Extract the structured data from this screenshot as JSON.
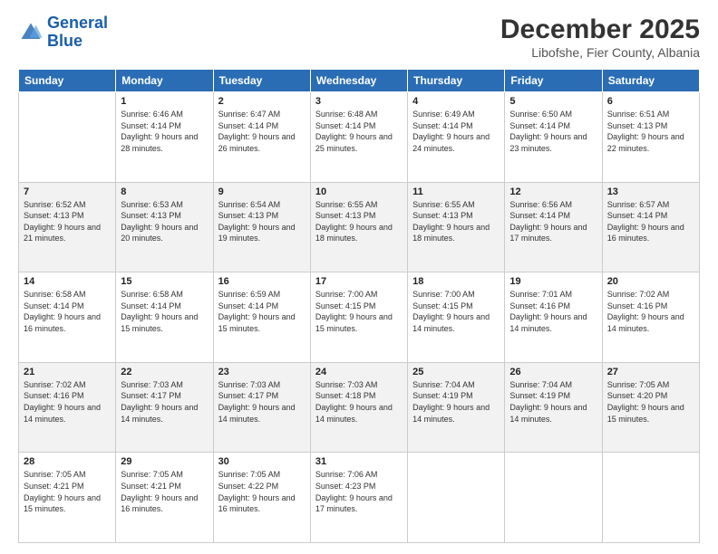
{
  "logo": {
    "line1": "General",
    "line2": "Blue"
  },
  "title": "December 2025",
  "subtitle": "Libofshe, Fier County, Albania",
  "days_of_week": [
    "Sunday",
    "Monday",
    "Tuesday",
    "Wednesday",
    "Thursday",
    "Friday",
    "Saturday"
  ],
  "weeks": [
    [
      {
        "num": "",
        "sunrise": "",
        "sunset": "",
        "daylight": ""
      },
      {
        "num": "1",
        "sunrise": "Sunrise: 6:46 AM",
        "sunset": "Sunset: 4:14 PM",
        "daylight": "Daylight: 9 hours and 28 minutes."
      },
      {
        "num": "2",
        "sunrise": "Sunrise: 6:47 AM",
        "sunset": "Sunset: 4:14 PM",
        "daylight": "Daylight: 9 hours and 26 minutes."
      },
      {
        "num": "3",
        "sunrise": "Sunrise: 6:48 AM",
        "sunset": "Sunset: 4:14 PM",
        "daylight": "Daylight: 9 hours and 25 minutes."
      },
      {
        "num": "4",
        "sunrise": "Sunrise: 6:49 AM",
        "sunset": "Sunset: 4:14 PM",
        "daylight": "Daylight: 9 hours and 24 minutes."
      },
      {
        "num": "5",
        "sunrise": "Sunrise: 6:50 AM",
        "sunset": "Sunset: 4:14 PM",
        "daylight": "Daylight: 9 hours and 23 minutes."
      },
      {
        "num": "6",
        "sunrise": "Sunrise: 6:51 AM",
        "sunset": "Sunset: 4:13 PM",
        "daylight": "Daylight: 9 hours and 22 minutes."
      }
    ],
    [
      {
        "num": "7",
        "sunrise": "Sunrise: 6:52 AM",
        "sunset": "Sunset: 4:13 PM",
        "daylight": "Daylight: 9 hours and 21 minutes."
      },
      {
        "num": "8",
        "sunrise": "Sunrise: 6:53 AM",
        "sunset": "Sunset: 4:13 PM",
        "daylight": "Daylight: 9 hours and 20 minutes."
      },
      {
        "num": "9",
        "sunrise": "Sunrise: 6:54 AM",
        "sunset": "Sunset: 4:13 PM",
        "daylight": "Daylight: 9 hours and 19 minutes."
      },
      {
        "num": "10",
        "sunrise": "Sunrise: 6:55 AM",
        "sunset": "Sunset: 4:13 PM",
        "daylight": "Daylight: 9 hours and 18 minutes."
      },
      {
        "num": "11",
        "sunrise": "Sunrise: 6:55 AM",
        "sunset": "Sunset: 4:13 PM",
        "daylight": "Daylight: 9 hours and 18 minutes."
      },
      {
        "num": "12",
        "sunrise": "Sunrise: 6:56 AM",
        "sunset": "Sunset: 4:14 PM",
        "daylight": "Daylight: 9 hours and 17 minutes."
      },
      {
        "num": "13",
        "sunrise": "Sunrise: 6:57 AM",
        "sunset": "Sunset: 4:14 PM",
        "daylight": "Daylight: 9 hours and 16 minutes."
      }
    ],
    [
      {
        "num": "14",
        "sunrise": "Sunrise: 6:58 AM",
        "sunset": "Sunset: 4:14 PM",
        "daylight": "Daylight: 9 hours and 16 minutes."
      },
      {
        "num": "15",
        "sunrise": "Sunrise: 6:58 AM",
        "sunset": "Sunset: 4:14 PM",
        "daylight": "Daylight: 9 hours and 15 minutes."
      },
      {
        "num": "16",
        "sunrise": "Sunrise: 6:59 AM",
        "sunset": "Sunset: 4:14 PM",
        "daylight": "Daylight: 9 hours and 15 minutes."
      },
      {
        "num": "17",
        "sunrise": "Sunrise: 7:00 AM",
        "sunset": "Sunset: 4:15 PM",
        "daylight": "Daylight: 9 hours and 15 minutes."
      },
      {
        "num": "18",
        "sunrise": "Sunrise: 7:00 AM",
        "sunset": "Sunset: 4:15 PM",
        "daylight": "Daylight: 9 hours and 14 minutes."
      },
      {
        "num": "19",
        "sunrise": "Sunrise: 7:01 AM",
        "sunset": "Sunset: 4:16 PM",
        "daylight": "Daylight: 9 hours and 14 minutes."
      },
      {
        "num": "20",
        "sunrise": "Sunrise: 7:02 AM",
        "sunset": "Sunset: 4:16 PM",
        "daylight": "Daylight: 9 hours and 14 minutes."
      }
    ],
    [
      {
        "num": "21",
        "sunrise": "Sunrise: 7:02 AM",
        "sunset": "Sunset: 4:16 PM",
        "daylight": "Daylight: 9 hours and 14 minutes."
      },
      {
        "num": "22",
        "sunrise": "Sunrise: 7:03 AM",
        "sunset": "Sunset: 4:17 PM",
        "daylight": "Daylight: 9 hours and 14 minutes."
      },
      {
        "num": "23",
        "sunrise": "Sunrise: 7:03 AM",
        "sunset": "Sunset: 4:17 PM",
        "daylight": "Daylight: 9 hours and 14 minutes."
      },
      {
        "num": "24",
        "sunrise": "Sunrise: 7:03 AM",
        "sunset": "Sunset: 4:18 PM",
        "daylight": "Daylight: 9 hours and 14 minutes."
      },
      {
        "num": "25",
        "sunrise": "Sunrise: 7:04 AM",
        "sunset": "Sunset: 4:19 PM",
        "daylight": "Daylight: 9 hours and 14 minutes."
      },
      {
        "num": "26",
        "sunrise": "Sunrise: 7:04 AM",
        "sunset": "Sunset: 4:19 PM",
        "daylight": "Daylight: 9 hours and 14 minutes."
      },
      {
        "num": "27",
        "sunrise": "Sunrise: 7:05 AM",
        "sunset": "Sunset: 4:20 PM",
        "daylight": "Daylight: 9 hours and 15 minutes."
      }
    ],
    [
      {
        "num": "28",
        "sunrise": "Sunrise: 7:05 AM",
        "sunset": "Sunset: 4:21 PM",
        "daylight": "Daylight: 9 hours and 15 minutes."
      },
      {
        "num": "29",
        "sunrise": "Sunrise: 7:05 AM",
        "sunset": "Sunset: 4:21 PM",
        "daylight": "Daylight: 9 hours and 16 minutes."
      },
      {
        "num": "30",
        "sunrise": "Sunrise: 7:05 AM",
        "sunset": "Sunset: 4:22 PM",
        "daylight": "Daylight: 9 hours and 16 minutes."
      },
      {
        "num": "31",
        "sunrise": "Sunrise: 7:06 AM",
        "sunset": "Sunset: 4:23 PM",
        "daylight": "Daylight: 9 hours and 17 minutes."
      },
      {
        "num": "",
        "sunrise": "",
        "sunset": "",
        "daylight": ""
      },
      {
        "num": "",
        "sunrise": "",
        "sunset": "",
        "daylight": ""
      },
      {
        "num": "",
        "sunrise": "",
        "sunset": "",
        "daylight": ""
      }
    ]
  ]
}
